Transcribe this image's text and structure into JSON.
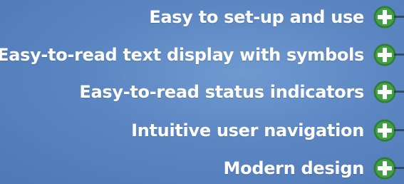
{
  "colors": {
    "background": "#5b86c2",
    "text": "#ffffff",
    "icon_fill": "#43a047",
    "icon_ring": "#2e7d32",
    "icon_plus": "#ffffff"
  },
  "features": [
    {
      "label": "Easy to set-up and use",
      "icon": "plus-circle-icon"
    },
    {
      "label": "Easy-to-read text display with symbols",
      "icon": "plus-circle-icon"
    },
    {
      "label": "Easy-to-read status indicators",
      "icon": "plus-circle-icon"
    },
    {
      "label": "Intuitive user navigation",
      "icon": "plus-circle-icon"
    },
    {
      "label": "Modern design",
      "icon": "plus-circle-icon"
    }
  ]
}
